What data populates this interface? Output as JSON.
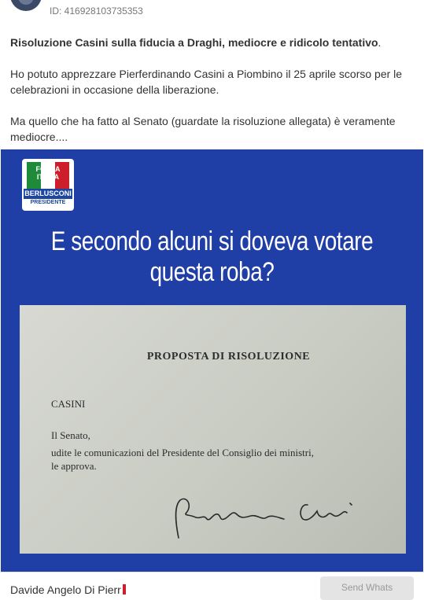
{
  "post": {
    "id_label": "ID: 416928103735353",
    "title": "Risoluzione Casini sulla fiducia a Draghi, mediocre e ridicolo tentativo",
    "title_end": ".",
    "paragraph_1": "Ho potuto apprezzare Pierferdinando Casini a Piombino il 25 aprile scorso per le celebrazioni in occasione della liberazione.",
    "paragraph_2": "Ma quello che ha fatto al Senato (guardate la risoluzione allegata) è veramente mediocre...."
  },
  "image": {
    "logo": {
      "line1": "FORZA",
      "line2": "ITALIA",
      "name": "BERLUSCONI",
      "sub": "PRESIDENTE"
    },
    "headline": "E  secondo alcuni si doveva votare questa roba?",
    "document": {
      "title": "PROPOSTA DI RISOLUZIONE",
      "name": "CASINI",
      "line1": "Il Senato,",
      "line2": "udite le comunicazioni del Presidente del Consiglio dei ministri,",
      "line3": "le approva."
    },
    "colors": {
      "banner": "#1f3ea6",
      "paper": "#d2d4cc"
    }
  },
  "footer": {
    "author": "Davide Angelo Di Pierr",
    "send_button": "Send Whats"
  }
}
